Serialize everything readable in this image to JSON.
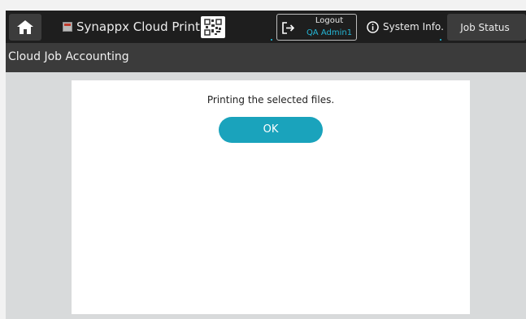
{
  "header": {
    "home_icon": "home-icon",
    "app_icon": "app-icon",
    "app_title": "Synappx Cloud Print",
    "qr_icon": "qr-code-icon",
    "logout_icon": "logout-icon",
    "logout_label": "Logout",
    "logout_user": "QA Admin1",
    "system_info_icon": "info-icon",
    "system_info_label": "System Info.",
    "job_status_label": "Job Status"
  },
  "page": {
    "title": "Cloud Job Accounting"
  },
  "dialog": {
    "message": "Printing the selected files.",
    "ok_label": "OK"
  },
  "colors": {
    "accent": "#1aa3bc",
    "topbar": "#1e1e1e",
    "titlebar": "#3b3b3b",
    "user_text": "#24b6d6"
  }
}
